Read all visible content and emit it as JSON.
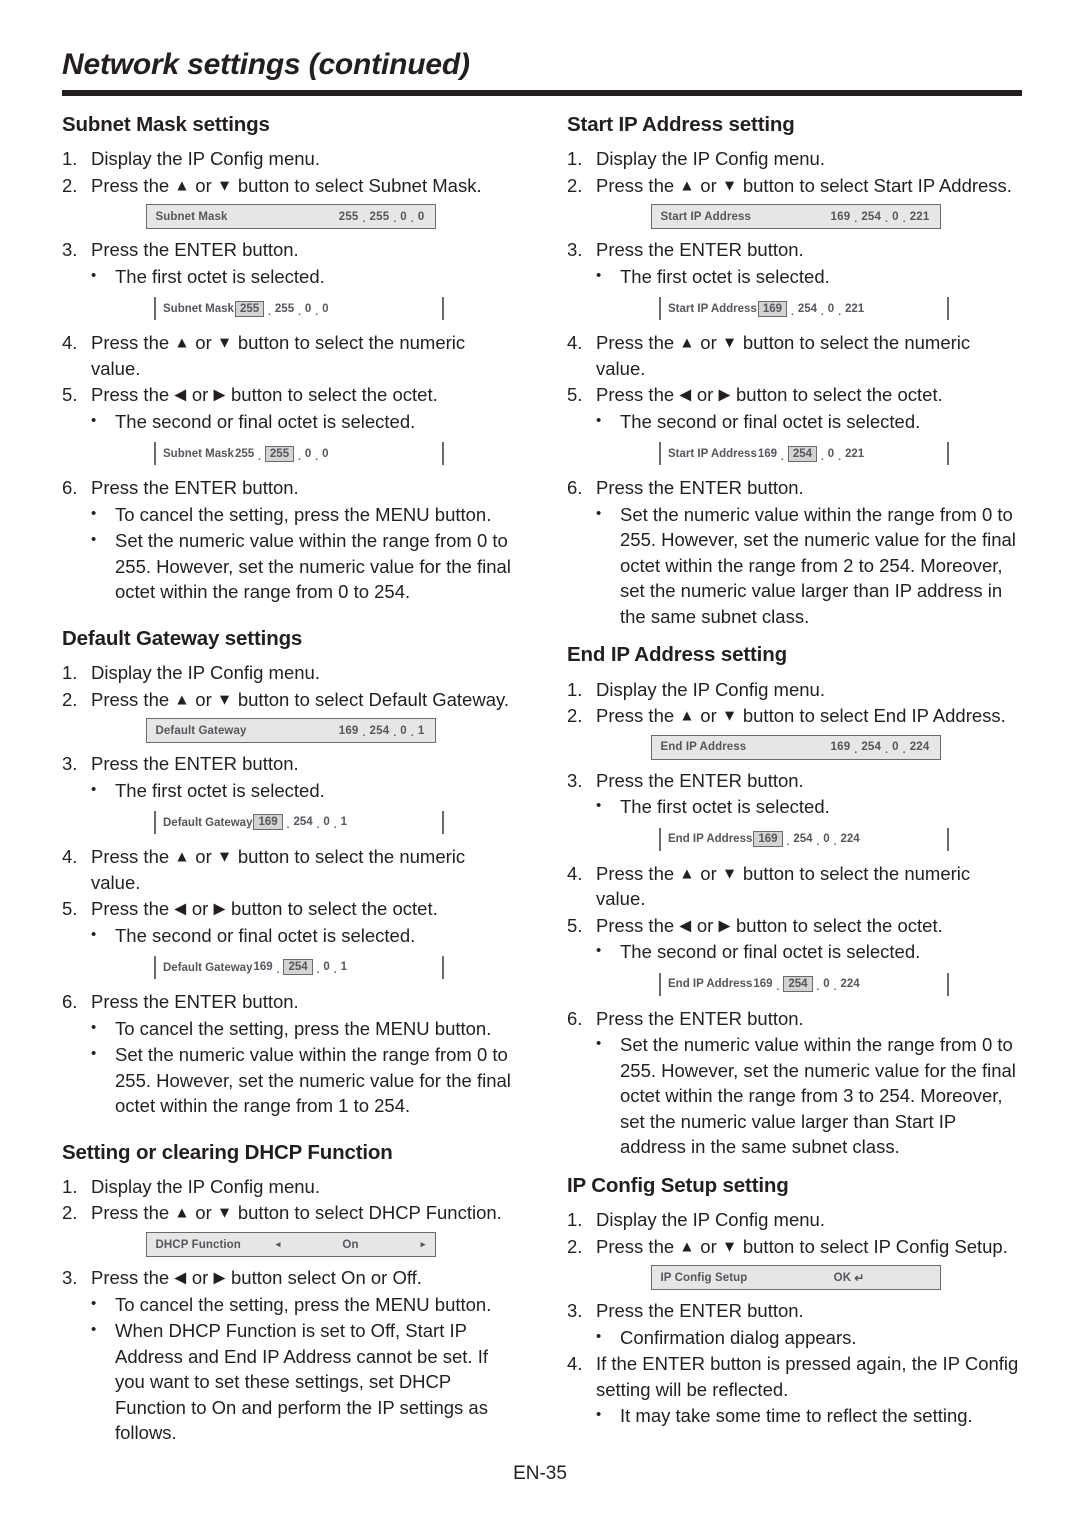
{
  "header": {
    "title": "Network settings (continued)"
  },
  "footer": {
    "page_label": "EN-35"
  },
  "symbols": {
    "up_arrow": "▲",
    "down_arrow": "▼",
    "left_arrow": "◀",
    "right_arrow": "▶",
    "bullet": "•",
    "tri_left": "◂",
    "tri_right": "▸",
    "enter_key": "↵",
    "dot_sep": "."
  },
  "left_column": {
    "sections": [
      {
        "heading": "Subnet Mask settings",
        "steps": [
          {
            "num": "1.",
            "text": "Display the IP Config menu."
          },
          {
            "num": "2.",
            "text_pre": "Press the ",
            "arrow1": "▲",
            "mid": " or ",
            "arrow2": "▼",
            "text_post": " button to select Subnet Mask."
          }
        ],
        "widget1": {
          "name": "subnet-mask-osd",
          "label": "Subnet Mask",
          "octets": [
            "255",
            "255",
            "0",
            "0"
          ],
          "selected_index": -1
        },
        "step3": {
          "num": "3.",
          "text": "Press the ENTER button."
        },
        "step3_bullet": "The first octet is selected.",
        "widget2": {
          "name": "subnet-mask-osd-first-selected",
          "label": "Subnet Mask",
          "octets": [
            "255",
            "255",
            "0",
            "0"
          ],
          "selected_index": 0
        },
        "step4": {
          "num": "4.",
          "text_pre": "Press the ",
          "arrow1": "▲",
          "mid": " or ",
          "arrow2": "▼",
          "text_post": " button to select the numeric value."
        },
        "step5": {
          "num": "5.",
          "text_pre": "Press the ",
          "arrow1": "◀",
          "mid": " or ",
          "arrow2": "▶",
          "text_post": " button to select the octet."
        },
        "step5_bullet": "The second or final octet is selected.",
        "widget3": {
          "name": "subnet-mask-osd-second-selected",
          "label": "Subnet Mask",
          "octets": [
            "255",
            "255",
            "0",
            "0"
          ],
          "selected_index": 1
        },
        "step6": {
          "num": "6.",
          "text": "Press the ENTER button."
        },
        "step6_bullets": [
          "To cancel the setting, press the MENU button.",
          "Set the numeric value within the range from 0 to 255. However, set the numeric value for the final octet within the range from 0 to 254."
        ]
      },
      {
        "heading": "Default Gateway settings",
        "steps": [
          {
            "num": "1.",
            "text": "Display the IP Config menu."
          },
          {
            "num": "2.",
            "text_pre": "Press the ",
            "arrow1": "▲",
            "mid": " or ",
            "arrow2": "▼",
            "text_post": " button to select Default Gateway."
          }
        ],
        "widget1": {
          "name": "default-gateway-osd",
          "label": "Default Gateway",
          "octets": [
            "169",
            "254",
            "0",
            "1"
          ],
          "selected_index": -1
        },
        "step3": {
          "num": "3.",
          "text": "Press the ENTER button."
        },
        "step3_bullet": "The first octet is selected.",
        "widget2": {
          "name": "default-gateway-osd-first-selected",
          "label": "Default Gateway",
          "octets": [
            "169",
            "254",
            "0",
            "1"
          ],
          "selected_index": 0
        },
        "step4": {
          "num": "4.",
          "text_pre": "Press the ",
          "arrow1": "▲",
          "mid": " or ",
          "arrow2": "▼",
          "text_post": " button to select the numeric value."
        },
        "step5": {
          "num": "5.",
          "text_pre": "Press the ",
          "arrow1": "◀",
          "mid": " or ",
          "arrow2": "▶",
          "text_post": " button to select the octet."
        },
        "step5_bullet": "The second or final octet is selected.",
        "widget3": {
          "name": "default-gateway-osd-second-selected",
          "label": "Default Gateway",
          "octets": [
            "169",
            "254",
            "0",
            "1"
          ],
          "selected_index": 1
        },
        "step6": {
          "num": "6.",
          "text": "Press the ENTER button."
        },
        "step6_bullets": [
          "To cancel the setting, press the MENU button.",
          "Set the numeric value within the range from 0 to 255. However, set the numeric value for the final octet within the range from 1 to 254."
        ]
      },
      {
        "heading": "Setting or clearing DHCP Function",
        "steps": [
          {
            "num": "1.",
            "text": "Display the IP Config menu."
          },
          {
            "num": "2.",
            "text_pre": "Press the ",
            "arrow1": "▲",
            "mid": " or ",
            "arrow2": "▼",
            "text_post": " button to select DHCP Function."
          }
        ],
        "widget_dhcp": {
          "name": "dhcp-function-osd",
          "label": "DHCP Function",
          "value": "On",
          "left_arrow": "◂",
          "right_arrow": "▸"
        },
        "step3": {
          "num": "3.",
          "text_pre": "Press the ",
          "arrow1": "◀",
          "mid": " or ",
          "arrow2": "▶",
          "text_post": " button select On or Off."
        },
        "step3_bullets": [
          "To cancel the setting, press the MENU button.",
          "When DHCP Function is set to Off, Start IP Address and End IP Address cannot be set. If you want to set these settings, set DHCP Function to On and perform the IP settings as follows."
        ]
      }
    ]
  },
  "right_column": {
    "sections": [
      {
        "heading": "Start IP Address setting",
        "steps": [
          {
            "num": "1.",
            "text": "Display the IP Config menu."
          },
          {
            "num": "2.",
            "text_pre": "Press the ",
            "arrow1": "▲",
            "mid": " or ",
            "arrow2": "▼",
            "text_post": " button to select Start IP Address."
          }
        ],
        "widget1": {
          "name": "start-ip-address-osd",
          "label": "Start IP Address",
          "octets": [
            "169",
            "254",
            "0",
            "221"
          ],
          "selected_index": -1
        },
        "step3": {
          "num": "3.",
          "text": "Press the ENTER button."
        },
        "step3_bullet": "The first octet is selected.",
        "widget2": {
          "name": "start-ip-address-osd-first-selected",
          "label": "Start IP Address",
          "octets": [
            "169",
            "254",
            "0",
            "221"
          ],
          "selected_index": 0
        },
        "step4": {
          "num": "4.",
          "text_pre": "Press the ",
          "arrow1": "▲",
          "mid": " or ",
          "arrow2": "▼",
          "text_post": " button to select the numeric value."
        },
        "step5": {
          "num": "5.",
          "text_pre": "Press the ",
          "arrow1": "◀",
          "mid": " or ",
          "arrow2": "▶",
          "text_post": " button to select the octet."
        },
        "step5_bullet": "The second or final octet is selected.",
        "widget3": {
          "name": "start-ip-address-osd-second-selected",
          "label": "Start IP Address",
          "octets": [
            "169",
            "254",
            "0",
            "221"
          ],
          "selected_index": 1
        },
        "step6": {
          "num": "6.",
          "text": "Press the ENTER button."
        },
        "step6_bullets": [
          "Set the numeric value within the range from 0 to 255. However, set the numeric value for the final octet within the range from 2 to 254. Moreover, set the numeric value larger than IP address in the same subnet class."
        ]
      },
      {
        "heading": "End IP Address setting",
        "steps": [
          {
            "num": "1.",
            "text": "Display the IP Config menu."
          },
          {
            "num": "2.",
            "text_pre": "Press the ",
            "arrow1": "▲",
            "mid": " or ",
            "arrow2": "▼",
            "text_post": " button to select End IP Address."
          }
        ],
        "widget1": {
          "name": "end-ip-address-osd",
          "label": "End IP Address",
          "octets": [
            "169",
            "254",
            "0",
            "224"
          ],
          "selected_index": -1
        },
        "step3": {
          "num": "3.",
          "text": "Press the ENTER button."
        },
        "step3_bullet": "The first octet is selected.",
        "widget2": {
          "name": "end-ip-address-osd-first-selected",
          "label": "End IP Address",
          "octets": [
            "169",
            "254",
            "0",
            "224"
          ],
          "selected_index": 0
        },
        "step4": {
          "num": "4.",
          "text_pre": "Press the ",
          "arrow1": "▲",
          "mid": " or ",
          "arrow2": "▼",
          "text_post": " button to select the numeric value."
        },
        "step5": {
          "num": "5.",
          "text_pre": "Press the ",
          "arrow1": "◀",
          "mid": " or ",
          "arrow2": "▶",
          "text_post": " button to select the octet."
        },
        "step5_bullet": "The second or final octet is selected.",
        "widget3": {
          "name": "end-ip-address-osd-second-selected",
          "label": "End IP Address",
          "octets": [
            "169",
            "254",
            "0",
            "224"
          ],
          "selected_index": 1
        },
        "step6": {
          "num": "6.",
          "text": "Press the ENTER button."
        },
        "step6_bullets": [
          "Set the numeric value within the range from 0 to 255. However, set the numeric value for the final octet within the range from 3 to 254. Moreover, set the numeric value larger than Start IP address in the same subnet class."
        ]
      },
      {
        "heading": "IP Config Setup setting",
        "steps": [
          {
            "num": "1.",
            "text": "Display the IP Config menu."
          },
          {
            "num": "2.",
            "text_pre": "Press the ",
            "arrow1": "▲",
            "mid": " or ",
            "arrow2": "▼",
            "text_post": " button to select IP Config Setup."
          }
        ],
        "widget_setup": {
          "name": "ip-config-setup-osd",
          "label": "IP Config Setup",
          "value": "OK",
          "enter_symbol": "↵"
        },
        "step3": {
          "num": "3.",
          "text": "Press the ENTER button."
        },
        "step3_bullet": "Confirmation dialog appears.",
        "step4": {
          "num": "4.",
          "text": "If the ENTER button is pressed again, the IP Config setting will be reflected."
        },
        "step4_bullet": "It may take some time to reflect the setting."
      }
    ]
  }
}
